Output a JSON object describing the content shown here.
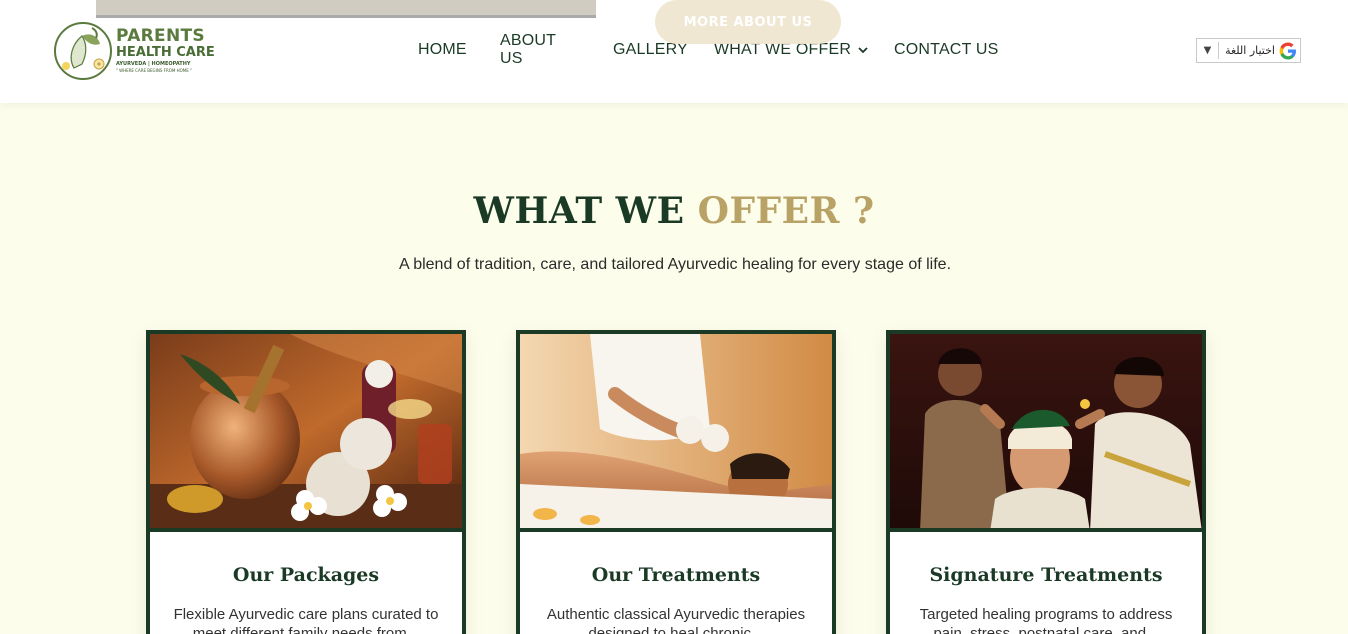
{
  "header": {
    "logo": {
      "line1": "PARENTS",
      "line2": "HEALTH CARE",
      "line3": "AYURVEDA  |  HOMEOPATHY",
      "line4": "\" WHERE CARE BEGINS FROM HOME \""
    },
    "nav": {
      "home": "HOME",
      "about": "ABOUT US",
      "gallery": "GALLERY",
      "offer": "WHAT WE OFFER",
      "contact": "CONTACT US"
    },
    "language": {
      "label": "اختيار اللغة",
      "arrow": "▼",
      "icon": "google-icon"
    },
    "background_button": "MORE ABOUT US"
  },
  "section": {
    "title_main": "WHAT WE",
    "title_accent": "OFFER ?",
    "subtitle": "A blend of tradition, care, and tailored Ayurvedic healing for every stage of life."
  },
  "cards": [
    {
      "title": "Our Packages",
      "text": "Flexible Ayurvedic care plans curated to meet different family needs from..."
    },
    {
      "title": "Our Treatments",
      "text": "Authentic classical Ayurvedic therapies designed to heal chronic..."
    },
    {
      "title": "Signature Treatments",
      "text": "Targeted healing programs to address pain, stress, postnatal care, and..."
    }
  ],
  "colors": {
    "primary": "#1b3a26",
    "accent": "#b9a266",
    "background": "#fdfdeb"
  }
}
